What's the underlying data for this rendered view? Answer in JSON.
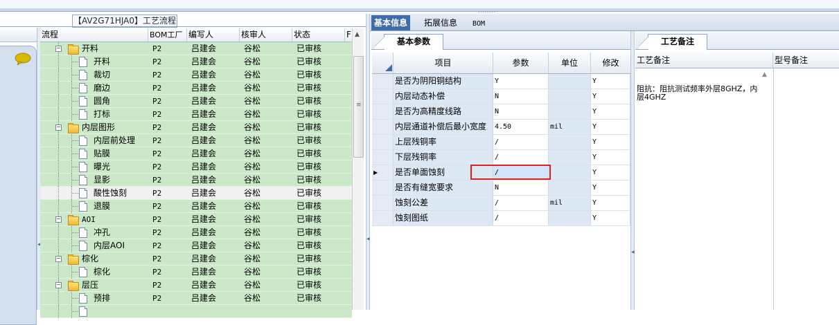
{
  "window": {
    "process_title": "【AV2G71HJA0】工艺流程",
    "grip": "........"
  },
  "tree_grid": {
    "columns": [
      "流程",
      "BOM工厂",
      "编写人",
      "核审人",
      "状态",
      "F"
    ],
    "rows": [
      {
        "name": "开料",
        "type": "folder",
        "level": 0,
        "expanded": true,
        "bom": "P2",
        "writer": "吕建会",
        "reviewer": "谷松",
        "status": "已审核"
      },
      {
        "name": "开料",
        "type": "item",
        "level": 1,
        "bom": "P2",
        "writer": "吕建会",
        "reviewer": "谷松",
        "status": "已审核"
      },
      {
        "name": "裁切",
        "type": "item",
        "level": 1,
        "bom": "P2",
        "writer": "吕建会",
        "reviewer": "谷松",
        "status": "已审核"
      },
      {
        "name": "磨边",
        "type": "item",
        "level": 1,
        "bom": "P2",
        "writer": "吕建会",
        "reviewer": "谷松",
        "status": "已审核"
      },
      {
        "name": "圆角",
        "type": "item",
        "level": 1,
        "bom": "P2",
        "writer": "吕建会",
        "reviewer": "谷松",
        "status": "已审核"
      },
      {
        "name": "打标",
        "type": "item",
        "level": 1,
        "bom": "P2",
        "writer": "吕建会",
        "reviewer": "谷松",
        "status": "已审核"
      },
      {
        "name": "内层图形",
        "type": "folder",
        "level": 0,
        "expanded": true,
        "bom": "P2",
        "writer": "吕建会",
        "reviewer": "谷松",
        "status": "已审核"
      },
      {
        "name": "内层前处理",
        "type": "item",
        "level": 1,
        "bom": "P2",
        "writer": "吕建会",
        "reviewer": "谷松",
        "status": "已审核"
      },
      {
        "name": "贴膜",
        "type": "item",
        "level": 1,
        "bom": "P2",
        "writer": "吕建会",
        "reviewer": "谷松",
        "status": "已审核"
      },
      {
        "name": "曝光",
        "type": "item",
        "level": 1,
        "bom": "P2",
        "writer": "吕建会",
        "reviewer": "谷松",
        "status": "已审核"
      },
      {
        "name": "显影",
        "type": "item",
        "level": 1,
        "bom": "P2",
        "writer": "吕建会",
        "reviewer": "谷松",
        "status": "已审核"
      },
      {
        "name": "酸性蚀刻",
        "type": "item",
        "level": 1,
        "selected": true,
        "bom": "P2",
        "writer": "吕建会",
        "reviewer": "谷松",
        "status": "已审核"
      },
      {
        "name": "退膜",
        "type": "item",
        "level": 1,
        "bom": "P2",
        "writer": "吕建会",
        "reviewer": "谷松",
        "status": "已审核"
      },
      {
        "name": "AOI",
        "type": "folder",
        "level": 0,
        "expanded": true,
        "mono": true,
        "bom": "P2",
        "writer": "吕建会",
        "reviewer": "谷松",
        "status": "已审核"
      },
      {
        "name": "冲孔",
        "type": "item",
        "level": 1,
        "bom": "P2",
        "writer": "吕建会",
        "reviewer": "谷松",
        "status": "已审核"
      },
      {
        "name": "内层AOI",
        "type": "item",
        "level": 1,
        "bom": "P2",
        "writer": "吕建会",
        "reviewer": "谷松",
        "status": "已审核"
      },
      {
        "name": "棕化",
        "type": "folder",
        "level": 0,
        "expanded": true,
        "bom": "P2",
        "writer": "吕建会",
        "reviewer": "谷松",
        "status": "已审核"
      },
      {
        "name": "棕化",
        "type": "item",
        "level": 1,
        "bom": "P2",
        "writer": "吕建会",
        "reviewer": "谷松",
        "status": "已审核"
      },
      {
        "name": "层压",
        "type": "folder",
        "level": 0,
        "expanded": true,
        "bom": "P2",
        "writer": "吕建会",
        "reviewer": "谷松",
        "status": "已审核"
      },
      {
        "name": "预排",
        "type": "item",
        "level": 1,
        "bom": "P2",
        "writer": "吕建会",
        "reviewer": "谷松",
        "status": "已审核"
      },
      {
        "name": "",
        "type": "item",
        "level": 1,
        "bom": "",
        "writer": "",
        "reviewer": "",
        "status": ""
      }
    ]
  },
  "tabs": [
    {
      "label": "基本信息",
      "active": true
    },
    {
      "label": "拓展信息",
      "active": false
    },
    {
      "label": "BOM",
      "active": false
    }
  ],
  "param_panel": {
    "tab_label": "基本参数",
    "columns": [
      "项目",
      "参数",
      "单位",
      "修改"
    ],
    "rows": [
      {
        "item": "是否为阴阳铜结构",
        "param": "Y",
        "unit": "",
        "mod": "Y"
      },
      {
        "item": "内层动态补偿",
        "param": "N",
        "unit": "",
        "mod": "Y"
      },
      {
        "item": "是否为高精度线路",
        "param": "N",
        "unit": "",
        "mod": "Y"
      },
      {
        "item": "内层通道补偿后最小宽度",
        "param": "4.50",
        "unit": "mil",
        "mod": "Y"
      },
      {
        "item": "上层残铜率",
        "param": "/",
        "unit": "",
        "mod": "Y"
      },
      {
        "item": "下层残铜率",
        "param": "/",
        "unit": "",
        "mod": "Y"
      },
      {
        "item": "是否单面蚀刻",
        "param": "/",
        "unit": "",
        "mod": "Y",
        "current": true
      },
      {
        "item": "是否有缝宽要求",
        "param": "N",
        "unit": "",
        "mod": "Y"
      },
      {
        "item": "蚀刻公差",
        "param": "/",
        "unit": "mil",
        "mod": "Y"
      },
      {
        "item": "蚀刻图纸",
        "param": "/",
        "unit": "",
        "mod": "Y"
      }
    ]
  },
  "remark_panel": {
    "tab_label": "工艺备注",
    "columns": [
      "工艺备注",
      "型号备注"
    ],
    "process_remark": "阻抗：阻抗测试频率外层8GHZ，内层4GHZ"
  },
  "colors": {
    "row_green": "#cbe8c9",
    "active_tab": "#3e6ca9",
    "highlight_box": "#e0201e"
  }
}
